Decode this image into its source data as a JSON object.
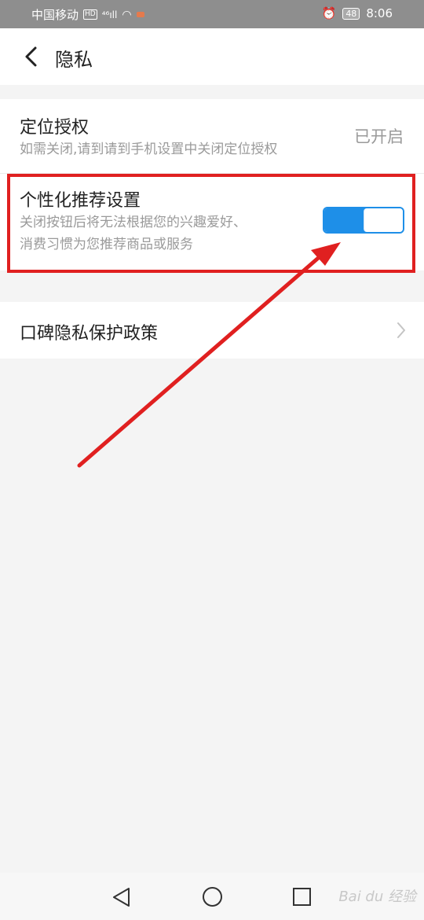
{
  "status_bar": {
    "carrier": "中国移动",
    "hd_badge": "HD",
    "signal_text": "⁴⁶ıll",
    "battery": "48",
    "time": "8:06"
  },
  "header": {
    "title": "隐私"
  },
  "settings": {
    "location": {
      "title": "定位授权",
      "description": "如需关闭,请到请到手机设置中关闭定位授权",
      "value": "已开启"
    },
    "personalized": {
      "title": "个性化推荐设置",
      "description_line1": "关闭按钮后将无法根据您的兴趣爱好、",
      "description_line2": "消费习惯为您推荐商品或服务",
      "enabled": true
    },
    "policy": {
      "title": "口碑隐私保护政策"
    }
  },
  "watermark": "Bai du 经验",
  "colors": {
    "accent": "#1e8fe8",
    "annotation": "#e02020"
  }
}
